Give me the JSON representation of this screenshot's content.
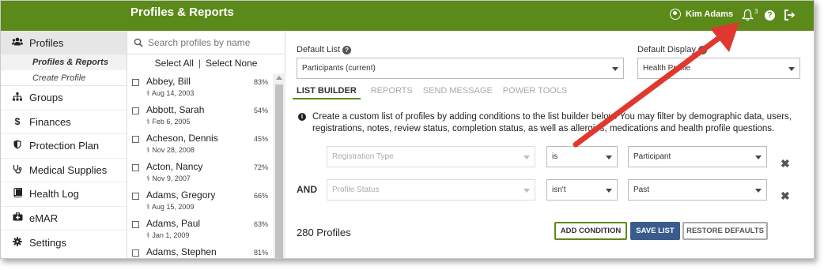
{
  "app": {
    "title": "Profiles & Reports"
  },
  "header": {
    "user_name": "Kim Adams",
    "notification_count": "3",
    "help_symbol": "?"
  },
  "sidebar": {
    "active": {
      "label": "Profiles",
      "icon": "users-icon"
    },
    "sub_items": [
      "Profiles & Reports",
      "Create Profile"
    ],
    "items": [
      {
        "label": "Groups",
        "icon": "sitemap-icon"
      },
      {
        "label": "Finances",
        "icon": "dollar-icon"
      },
      {
        "label": "Protection Plan",
        "icon": "shield-icon"
      },
      {
        "label": "Medical Supplies",
        "icon": "stethoscope-icon"
      },
      {
        "label": "Health Log",
        "icon": "book-icon"
      },
      {
        "label": "eMAR",
        "icon": "medkit-icon"
      },
      {
        "label": "Settings",
        "icon": "gear-icon"
      }
    ]
  },
  "profile_list": {
    "search_placeholder": "Search profiles by name",
    "select_all": "Select All",
    "separator": "|",
    "select_none": "Select None",
    "rows": [
      {
        "name": "Abbey, Bill",
        "date": "Aug 14, 2003",
        "percent": "83%"
      },
      {
        "name": "Abbott, Sarah",
        "date": "Feb 6, 2005",
        "percent": "54%"
      },
      {
        "name": "Acheson, Dennis",
        "date": "Nov 28, 2008",
        "percent": "45%"
      },
      {
        "name": "Acton, Nancy",
        "date": "Nov 9, 2007",
        "percent": "72%"
      },
      {
        "name": "Adams, Gregory",
        "date": "Aug 15, 2009",
        "percent": "66%"
      },
      {
        "name": "Adams, Paul",
        "date": "Jan 1, 2009",
        "percent": "63%"
      },
      {
        "name": "Adams, Stephen",
        "date": "",
        "percent": "81%"
      }
    ]
  },
  "main": {
    "default_list_label": "Default List",
    "default_list_value": "Participants (current)",
    "default_display_label": "Default Display",
    "default_display_value": "Health Profile",
    "tabs": [
      "LIST BUILDER",
      "REPORTS",
      "SEND MESSAGE",
      "POWER TOOLS"
    ],
    "info_text": "Create a custom list of profiles by adding conditions to the list builder below. You may filter by demographic data, users, registrations, notes, review status, completion status, as well as allergies, medications and health profile questions.",
    "conditions": [
      {
        "connector": "",
        "field": "Registration Type",
        "operator": "is",
        "value": "Participant"
      },
      {
        "connector": "AND",
        "field": "Profile Status",
        "operator": "isn't",
        "value": "Past"
      }
    ],
    "remove_symbol": "✖",
    "profile_count": "280 Profiles",
    "buttons": {
      "add": "ADD CONDITION",
      "save": "SAVE LIST",
      "restore": "RESTORE DEFAULTS"
    }
  },
  "colors": {
    "brand_green": "#5b8a1a",
    "save_blue": "#3a5c8c",
    "arrow_red": "#e0382e"
  }
}
